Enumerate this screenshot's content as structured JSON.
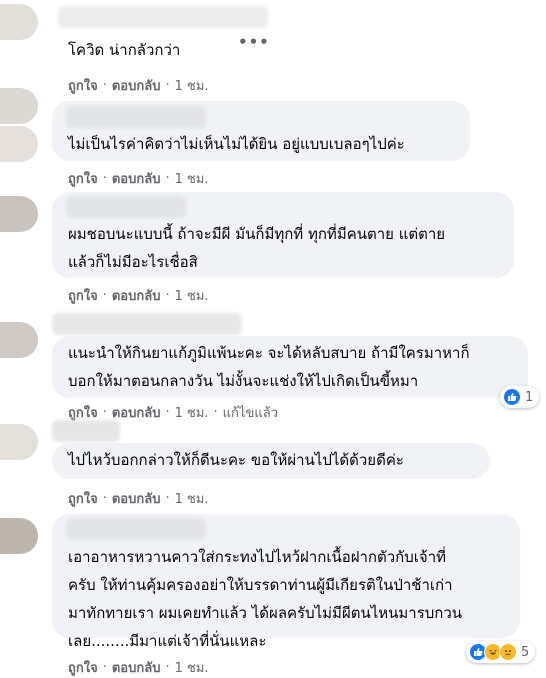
{
  "comments": [
    {
      "text": "โควิด น่ากลัวกว่า",
      "actions": {
        "like": "ถูกใจ",
        "reply": "ตอบกลับ",
        "time": "1 ชม."
      }
    },
    {
      "text": "ไม่เป็นไรค่าคิดว่าไม่เห็นไม่ได้ยิน อยู่แบบเบลอๆไปค่ะ",
      "actions": {
        "like": "ถูกใจ",
        "reply": "ตอบกลับ",
        "time": "1 ชม."
      }
    },
    {
      "text": "ผมชอบนะแบบนี้ ถ้าจะมีผี มันก็มีทุกที่ ทุกที่มีคนตาย แต่ตาย\nแล้วก็ไม่มีอะไรเชื่อสิ",
      "actions": {
        "like": "ถูกใจ",
        "reply": "ตอบกลับ",
        "time": "1 ชม."
      }
    },
    {
      "text": "แนะนำให้กินยาแก้ภูมิแพ้นะคะ จะได้หลับสบาย ถ้ามีใครมาหาก็\nบอกให้มาตอนกลางวัน ไม่งั้นจะแช่งให้ไปเกิดเป็นขี้หมา",
      "actions": {
        "like": "ถูกใจ",
        "reply": "ตอบกลับ",
        "time": "1 ชม.",
        "edited": "แก้ไขแล้ว"
      },
      "reactions": {
        "count": "1",
        "icons": [
          "like-icon"
        ]
      }
    },
    {
      "text": "ไปไหว้บอกกล่าวให้ก็ดีนะคะ ขอให้ผ่านไปได้ด้วยดีค่ะ",
      "actions": {
        "like": "ถูกใจ",
        "reply": "ตอบกลับ",
        "time": "1 ชม."
      }
    },
    {
      "text": "เอาอาหารหวานคาวใส่กระทงไปไหว้ฝากเนื้อฝากตัวกับเจ้าที่\nครับ ให้ท่านคุ้มครองอย่าให้บรรดาท่านผู้มีเกียรติในป่าช้าเก่า\nมาทักทายเรา ผมเคยทำแล้ว ได้ผลครับไม่มีผีตนไหนมารบกวน\nเลย........มีมาแต่เจ้าที่นั่นแหละ",
      "actions": {
        "like": "ถูกใจ",
        "reply": "ตอบกลับ",
        "time": "1 ชม."
      },
      "reactions": {
        "count": "5",
        "icons": [
          "like-icon",
          "haha-icon",
          "sad-icon"
        ]
      }
    }
  ],
  "colors": {
    "bubble": "#f0f2f5",
    "secondary_text": "#65676b",
    "like_blue": "#1877f2",
    "emoji_yellow": "#f7b928"
  },
  "more_icon": "more-options-icon"
}
